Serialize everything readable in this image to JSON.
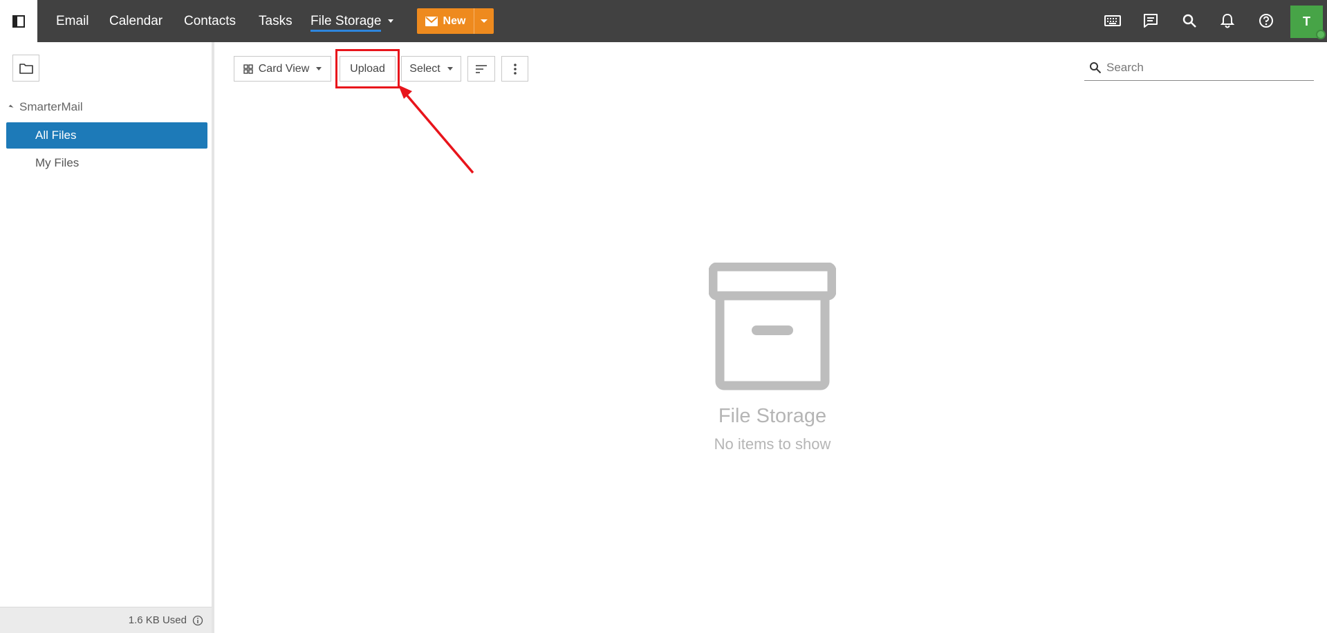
{
  "nav": {
    "items": [
      {
        "label": "Email"
      },
      {
        "label": "Calendar"
      },
      {
        "label": "Contacts"
      },
      {
        "label": "Tasks"
      },
      {
        "label": "File Storage"
      }
    ],
    "new_button": "New",
    "avatar_initial": "T",
    "icons": [
      "keyboard-icon",
      "chat-icon",
      "search-icon",
      "bell-icon",
      "help-icon"
    ]
  },
  "sidebar": {
    "root_label": "SmarterMail",
    "items": [
      {
        "label": "All Files",
        "selected": true
      },
      {
        "label": "My Files",
        "selected": false
      }
    ],
    "quota_text": "1.6 KB Used"
  },
  "toolbar": {
    "view_label": "Card View",
    "upload_label": "Upload",
    "select_label": "Select",
    "search_placeholder": "Search"
  },
  "empty_state": {
    "title": "File Storage",
    "subtitle": "No items to show"
  },
  "colors": {
    "topbar": "#414141",
    "accent_orange": "#ee8a1e",
    "selected_blue": "#1d7ab8",
    "highlight_red": "#e8141b",
    "avatar_green": "#47a447"
  }
}
